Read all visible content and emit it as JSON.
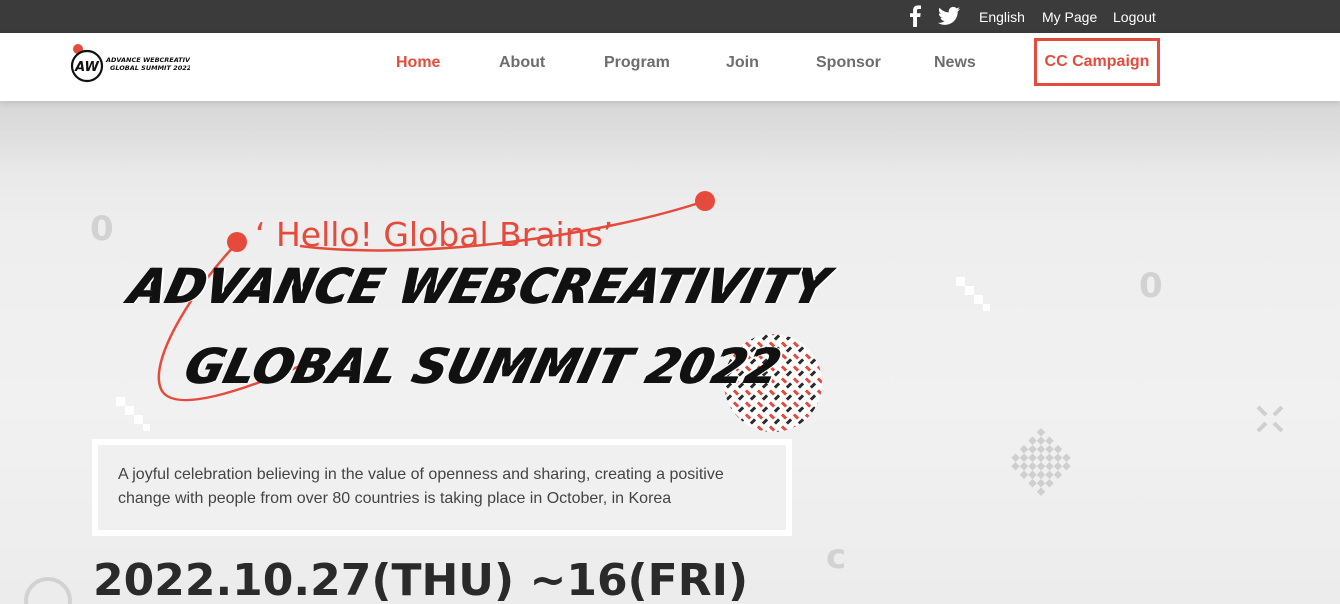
{
  "topbar": {
    "icons": [
      "facebook-icon",
      "twitter-icon"
    ],
    "links": [
      "English",
      "My Page",
      "Logout"
    ]
  },
  "nav": {
    "logo": {
      "text_line1": "ADVANCE WEBCREATIVITY",
      "text_line2": "GLOBAL SUMMIT 2022",
      "mark": "AW"
    },
    "items": [
      "Home",
      "About",
      "Program",
      "Join",
      "Sponsor",
      "News"
    ],
    "active": "Home",
    "cta": "CC Campaign"
  },
  "hero": {
    "greeting": "‘ Hello! Global Brains’",
    "title_line1": "ADVANCE WEBCREATIVITY",
    "title_line2": "GLOBAL SUMMIT 2022",
    "description": "A joyful celebration believing in the value of openness and sharing, creating a positive change with people from over 80 countries is taking place in October, in Korea",
    "date": "2022.10.27(THU) ~16(FRI)"
  },
  "colors": {
    "accent": "#e54b3c",
    "topbar_bg": "#3b3b3b",
    "text_dark": "#2a2a2a",
    "nav_text": "#6d6d6d"
  }
}
